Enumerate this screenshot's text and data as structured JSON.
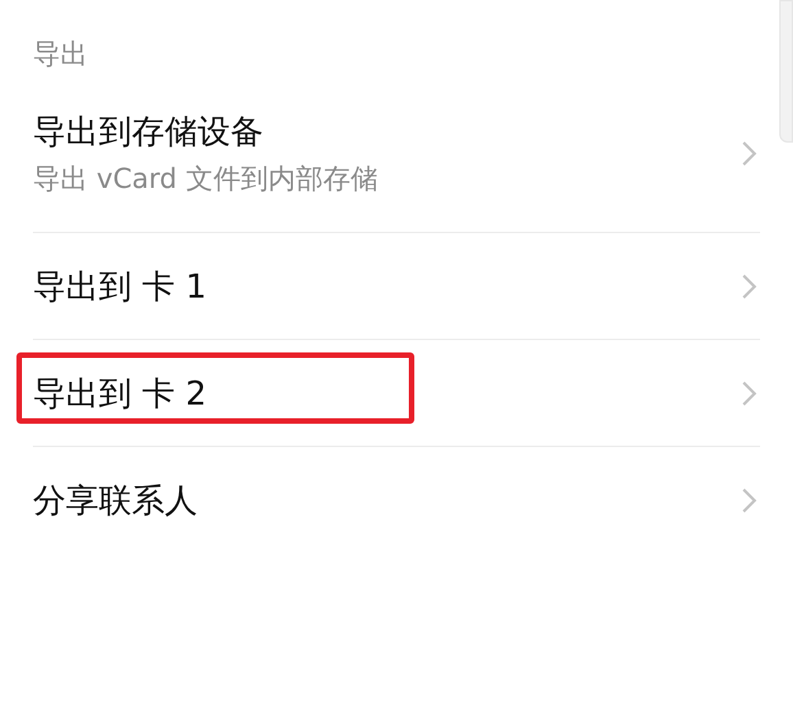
{
  "section_header": "导出",
  "items": [
    {
      "title": "导出到存储设备",
      "subtitle": "导出 vCard 文件到内部存储",
      "highlighted": false
    },
    {
      "title": "导出到 卡 1",
      "highlighted": false
    },
    {
      "title": "导出到 卡 2",
      "highlighted": true
    },
    {
      "title": "分享联系人",
      "highlighted": false
    }
  ]
}
